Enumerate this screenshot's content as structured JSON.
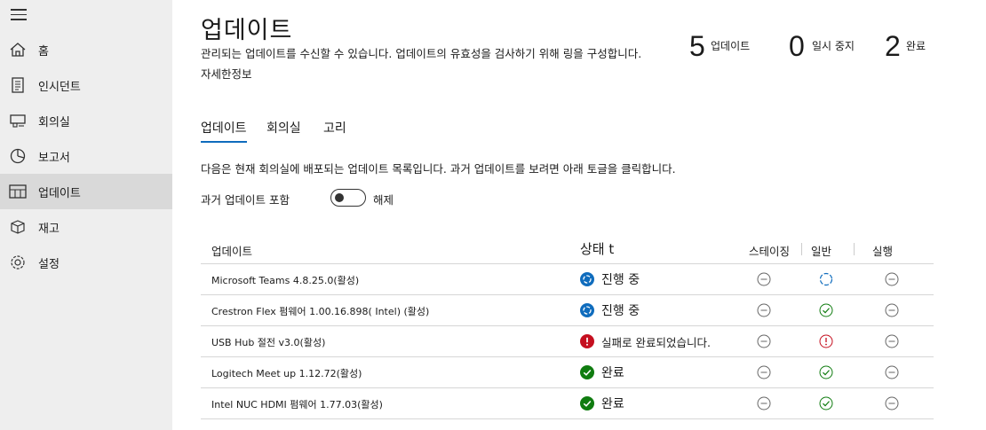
{
  "sidebar": {
    "items": [
      {
        "label": "홈",
        "icon": "home-icon"
      },
      {
        "label": "인시던트",
        "icon": "clipboard-icon"
      },
      {
        "label": "회의실",
        "icon": "room-icon"
      },
      {
        "label": "보고서",
        "icon": "pie-chart-icon"
      },
      {
        "label": "업데이트",
        "icon": "updates-icon",
        "active": true
      },
      {
        "label": "재고",
        "icon": "inventory-icon"
      },
      {
        "label": "설정",
        "icon": "gear-icon"
      }
    ]
  },
  "header": {
    "title": "업데이트",
    "description": "관리되는 업데이트를 수신할 수 있습니다. 업데이트의 유효성을 검사하기 위해 링을 구성합니다.",
    "more_link": "자세한정보"
  },
  "stats": [
    {
      "value": "5",
      "label": "업데이트"
    },
    {
      "value": "0",
      "label": "일시 중지"
    },
    {
      "value": "2",
      "label": "완료"
    }
  ],
  "tabs": [
    {
      "label": "업데이트",
      "active": true
    },
    {
      "label": "회의실"
    },
    {
      "label": "고리"
    }
  ],
  "list_description": "다음은 현재 회의실에 배포되는 업데이트 목록입니다. 과거 업데이트를 보려면 아래 토글을 클릭합니다.",
  "toggle": {
    "label": "과거 업데이트 포함",
    "state": "해제",
    "on": false
  },
  "table": {
    "columns": {
      "name": "업데이트",
      "status": "상태 t",
      "staging": "스테이징",
      "general": "일반",
      "run": "실행"
    },
    "rows": [
      {
        "name": "Microsoft Teams 4.8.25.0(활성)",
        "status": "진행 중",
        "status_icon": "in-progress",
        "staging": "none",
        "general": "progress",
        "run": "none"
      },
      {
        "name": "Crestron Flex 펌웨어 1.00.16.898( Intel) (활성)",
        "status": "진행 중",
        "status_icon": "in-progress",
        "staging": "none",
        "general": "success",
        "run": "none"
      },
      {
        "name": "USB Hub 절전 v3.0(활성)",
        "status": "실패로 완료되었습니다.",
        "status_icon": "error",
        "staging": "none",
        "general": "error",
        "run": "none"
      },
      {
        "name": "Logitech Meet up 1.12.72(활성)",
        "status": "완료",
        "status_icon": "success",
        "staging": "none",
        "general": "success",
        "run": "none"
      },
      {
        "name": "Intel NUC HDMI     펌웨어 1.77.03(활성)",
        "status": "완료",
        "status_icon": "success",
        "staging": "none",
        "general": "success",
        "run": "none"
      }
    ]
  },
  "colors": {
    "accent": "#0f6cbd",
    "success": "#107c10",
    "error": "#c50f1f",
    "sidebar_bg": "#eeeeee",
    "active_bg": "#d9d9d9"
  }
}
